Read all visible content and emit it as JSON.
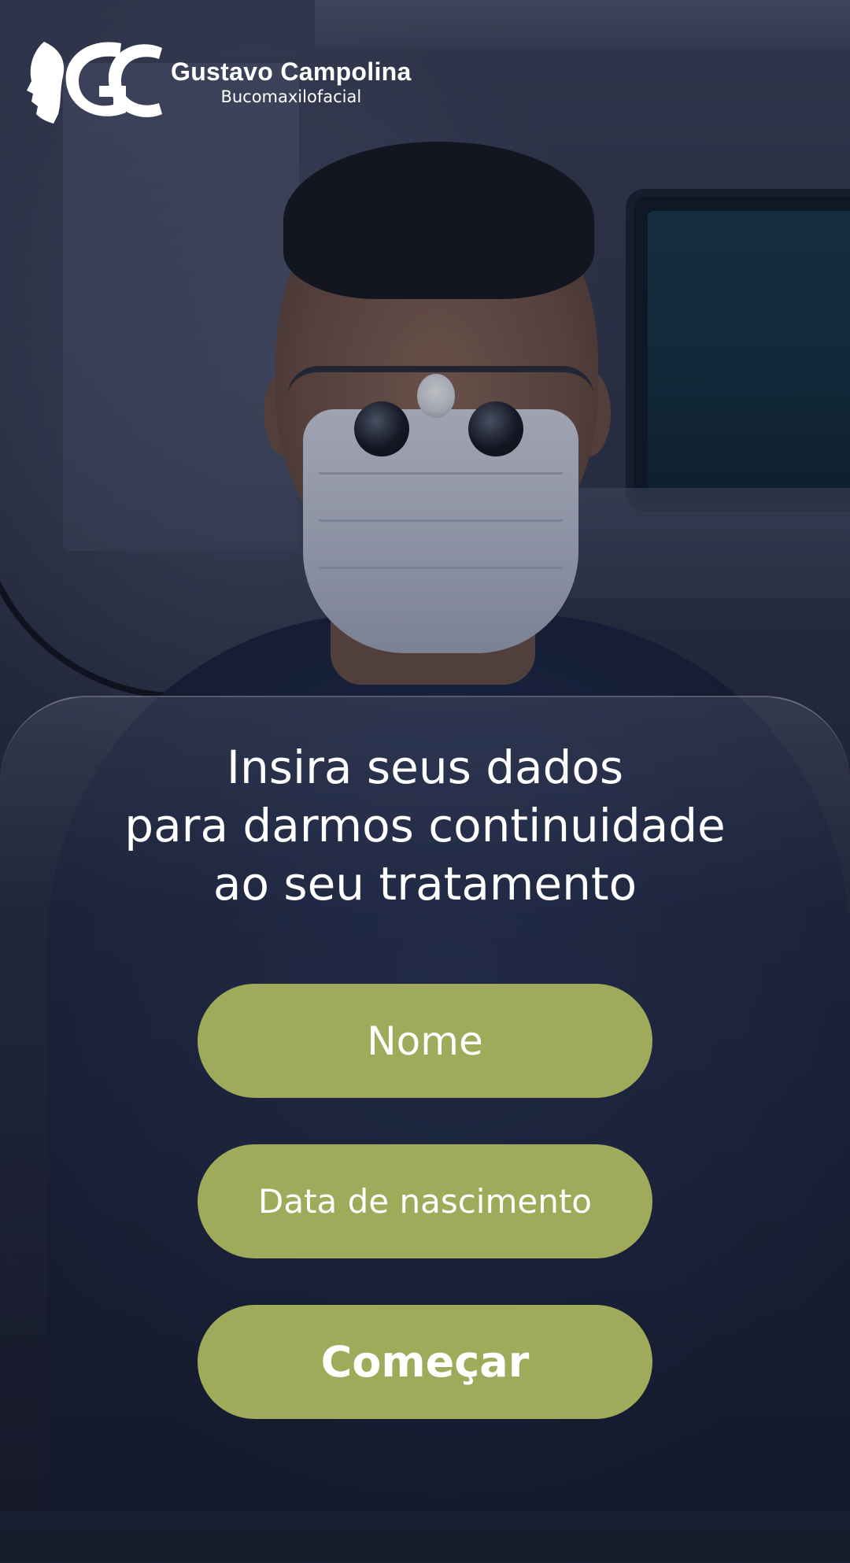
{
  "brand": {
    "name": "Gustavo Campolina",
    "subtitle": "Bucomaxilofacial",
    "monogram": "GC"
  },
  "form": {
    "headline": [
      "Insira seus dados",
      "para darmos continuidade",
      "ao seu tratamento"
    ],
    "name_placeholder": "Nome",
    "birthdate_placeholder": "Data de nascimento",
    "submit_label": "Começar"
  },
  "colors": {
    "accent": "#9faa5a",
    "text": "#ffffff",
    "background": "#1b2033"
  }
}
